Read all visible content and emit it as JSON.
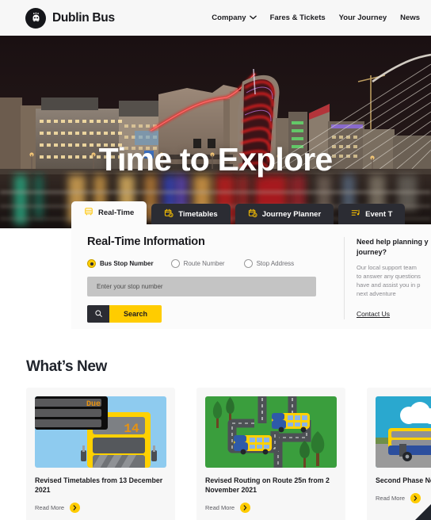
{
  "header": {
    "brand": "Dublin Bus",
    "logo_icon": "dublin-bus-roundel",
    "nav": [
      {
        "label": "Company",
        "has_chevron": true,
        "icon": "chevron-down-icon"
      },
      {
        "label": "Fares & Tickets",
        "has_chevron": false
      },
      {
        "label": "Your Journey",
        "has_chevron": false
      },
      {
        "label": "News",
        "has_chevron": false
      }
    ]
  },
  "hero": {
    "title": "Time to Explore",
    "image_alt": "Dublin docklands skyline at night with Convention Centre and Samuel Beckett Bridge"
  },
  "widget": {
    "tabs": [
      {
        "label": "Real-Time",
        "icon": "bus-icon",
        "active": true
      },
      {
        "label": "Timetables",
        "icon": "calendar-clock-icon",
        "active": false
      },
      {
        "label": "Journey Planner",
        "icon": "calendar-clock-icon",
        "active": false
      },
      {
        "label": "Event T",
        "icon": "event-list-icon",
        "active": false
      }
    ],
    "panel_title": "Real-Time Information",
    "radios": [
      {
        "label": "Bus Stop Number",
        "selected": true
      },
      {
        "label": "Route Number",
        "selected": false
      },
      {
        "label": "Stop Address",
        "selected": false
      }
    ],
    "stop_input": {
      "value": "",
      "placeholder": "Enter your stop number"
    },
    "search_icon": "search-icon",
    "search_label": "Search",
    "help": {
      "title_line1": "Need help planning y",
      "title_line2": "journey?",
      "body_line1": "Our local support team",
      "body_line2": "to answer any questions",
      "body_line3": "have and assist you in p",
      "body_line4": "next adventure",
      "contact_label": "Contact Us"
    }
  },
  "whats_new": {
    "heading": "What’s New",
    "read_more_label": "Read More",
    "arrow_icon": "chevron-right-icon",
    "cards": [
      {
        "title": "Revised Timetables from 13 December 2021",
        "art": "bus-destination-display",
        "art_labels": {
          "due": "Due",
          "route": "14"
        }
      },
      {
        "title": "Revised Routing on Route 25n from 2 November 2021",
        "art": "road-map-with-buses"
      },
      {
        "title": "Second Phase Network to lau",
        "art": "double-decker-bus-sky"
      }
    ]
  },
  "colors": {
    "brand_yellow": "#ffcc00",
    "dark": "#2b2c33",
    "page_bg": "#ffffff",
    "card_bg": "#f7f7f7",
    "header_bg": "#f7f7f7",
    "input_bg": "#c4c4c4"
  }
}
